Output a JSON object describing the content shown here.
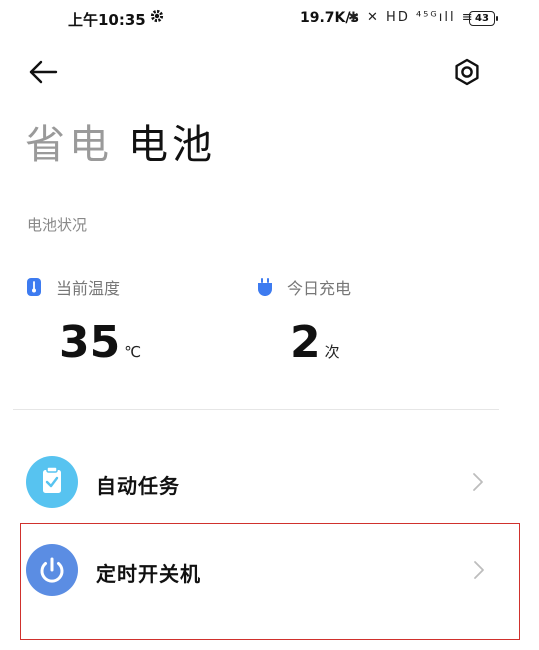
{
  "status_bar": {
    "time": "上午10:35",
    "speed": "19.7K/s",
    "icons_text": "✱ ✕ HD ⁴⁵ᴳıll ≡",
    "battery": "43"
  },
  "header": {
    "back_icon": "arrow-left-icon",
    "settings_icon": "settings-icon"
  },
  "tabs": [
    {
      "label": "省电",
      "active": false
    },
    {
      "label": "电池",
      "active": true
    }
  ],
  "battery_status": {
    "section_label": "电池状况",
    "temperature": {
      "label": "当前温度",
      "value": "35",
      "unit": "℃"
    },
    "charges_today": {
      "label": "今日充电",
      "value": "2",
      "unit": "次"
    }
  },
  "list": [
    {
      "label": "自动任务",
      "icon": "clipboard-check-icon",
      "color": "#57c3f0"
    },
    {
      "label": "定时开关机",
      "icon": "power-icon",
      "color": "#5b8de3",
      "highlighted": true
    }
  ],
  "colors": {
    "inactive_tab": "#9a9a9a",
    "highlight_border": "#d0312d",
    "temp_icon": "#3d7bf0",
    "charge_icon": "#3d7bf0"
  }
}
